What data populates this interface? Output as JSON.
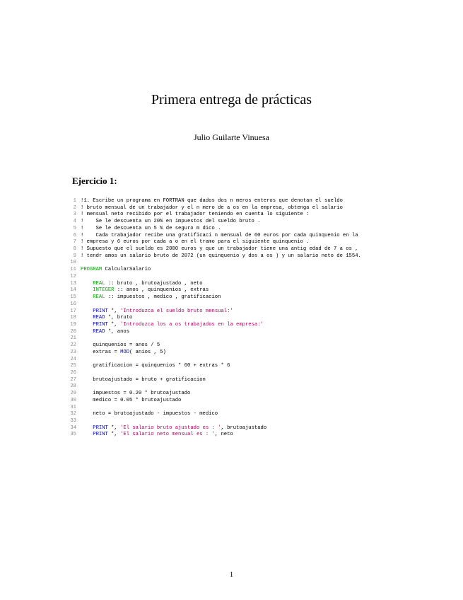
{
  "title": "Primera entrega de prácticas",
  "author": "Julio Guilarte Vinuesa",
  "section": "Ejercicio 1:",
  "page_number": "1",
  "code": [
    {
      "n": 1,
      "wrap": true,
      "segs": [
        {
          "t": "!1. Escribe un programa en FORTRAN que dados dos n meros enteros que denotan el sueldo"
        }
      ]
    },
    {
      "n": 2,
      "wrap": true,
      "segs": [
        {
          "t": "! bruto mensual de un trabajador y el n mero de a os en la empresa, obtenga el salario"
        }
      ]
    },
    {
      "n": 3,
      "wrap": true,
      "segs": [
        {
          "t": "! mensual neto recibido por el trabajador teniendo en cuenta lo siguiente :"
        }
      ]
    },
    {
      "n": 4,
      "segs": [
        {
          "t": "!    Se le descuenta un 20% en impuestos del sueldo bruto ."
        }
      ]
    },
    {
      "n": 5,
      "segs": [
        {
          "t": "!    Se le descuenta un 5 % de seguro m dico ."
        }
      ]
    },
    {
      "n": 6,
      "wrap": true,
      "segs": [
        {
          "t": "!    Cada trabajador recibe una gratificaci n mensual de 60 euros por cada quinquenio en la"
        }
      ]
    },
    {
      "n": 7,
      "wrap": true,
      "segs": [
        {
          "t": "! empresa y 6 euros por cada a o en el tramo para el siguiente quinquenio ."
        }
      ]
    },
    {
      "n": 8,
      "wrap": true,
      "segs": [
        {
          "t": "! Supuesto que el sueldo es 2000 euros y que un trabajador tiene una antig edad de 7 a os ,"
        }
      ]
    },
    {
      "n": 9,
      "wrap": true,
      "segs": [
        {
          "t": "! tendr amos un salario bruto de 2072 (un quinquenio y dos a os ) y un salario neto de 1554."
        }
      ]
    },
    {
      "n": 10,
      "segs": [
        {
          "t": ""
        }
      ]
    },
    {
      "n": 11,
      "segs": [
        {
          "t": "PROGRAM",
          "c": "kw"
        },
        {
          "t": " CalcularSalario"
        }
      ]
    },
    {
      "n": 12,
      "segs": [
        {
          "t": ""
        }
      ]
    },
    {
      "n": 13,
      "segs": [
        {
          "t": "    "
        },
        {
          "t": "REAL",
          "c": "kw"
        },
        {
          "t": " :: bruto , brutoajustado , neto"
        }
      ]
    },
    {
      "n": 14,
      "segs": [
        {
          "t": "    "
        },
        {
          "t": "INTEGER",
          "c": "kw"
        },
        {
          "t": " :: anos , quinquenios , extras"
        }
      ]
    },
    {
      "n": 15,
      "segs": [
        {
          "t": "    "
        },
        {
          "t": "REAL",
          "c": "kw"
        },
        {
          "t": " :: impuestos , medico , gratificacion"
        }
      ]
    },
    {
      "n": 16,
      "segs": [
        {
          "t": ""
        }
      ]
    },
    {
      "n": 17,
      "segs": [
        {
          "t": "    "
        },
        {
          "t": "PRINT",
          "c": "fn"
        },
        {
          "t": " *, "
        },
        {
          "t": "'Introduzca el sueldo bruto mensual:'",
          "c": "str"
        }
      ]
    },
    {
      "n": 18,
      "segs": [
        {
          "t": "    "
        },
        {
          "t": "READ",
          "c": "fn"
        },
        {
          "t": " *, bruto"
        }
      ]
    },
    {
      "n": 19,
      "segs": [
        {
          "t": "    "
        },
        {
          "t": "PRINT",
          "c": "fn"
        },
        {
          "t": " *, "
        },
        {
          "t": "'Introduzca los a os trabajados en la empresa:'",
          "c": "str"
        }
      ]
    },
    {
      "n": 20,
      "segs": [
        {
          "t": "    "
        },
        {
          "t": "READ",
          "c": "fn"
        },
        {
          "t": " *, anos"
        }
      ]
    },
    {
      "n": 21,
      "segs": [
        {
          "t": ""
        }
      ]
    },
    {
      "n": 22,
      "segs": [
        {
          "t": "    quinquenios = anos / 5"
        }
      ]
    },
    {
      "n": 23,
      "segs": [
        {
          "t": "    extras = "
        },
        {
          "t": "MOD",
          "c": "fn"
        },
        {
          "t": "( anios , 5)"
        }
      ]
    },
    {
      "n": 24,
      "segs": [
        {
          "t": ""
        }
      ]
    },
    {
      "n": 25,
      "segs": [
        {
          "t": "    gratificacion = quinquenios * 60 + extras * 6"
        }
      ]
    },
    {
      "n": 26,
      "segs": [
        {
          "t": ""
        }
      ]
    },
    {
      "n": 27,
      "segs": [
        {
          "t": "    brutoajustado = bruto + gratificacion"
        }
      ]
    },
    {
      "n": 28,
      "segs": [
        {
          "t": ""
        }
      ]
    },
    {
      "n": 29,
      "segs": [
        {
          "t": "    impuestos = 0.20 * brutoajustado"
        }
      ]
    },
    {
      "n": 30,
      "segs": [
        {
          "t": "    medico = 0.05 * brutoajustado"
        }
      ]
    },
    {
      "n": 31,
      "segs": [
        {
          "t": ""
        }
      ]
    },
    {
      "n": 32,
      "segs": [
        {
          "t": "    neto = brutoajustado - impuestos - medico"
        }
      ]
    },
    {
      "n": 33,
      "segs": [
        {
          "t": ""
        }
      ]
    },
    {
      "n": 34,
      "segs": [
        {
          "t": "    "
        },
        {
          "t": "PRINT",
          "c": "fn"
        },
        {
          "t": " *, "
        },
        {
          "t": "'El salario bruto ajustado es : '",
          "c": "str"
        },
        {
          "t": ", brutoajustado"
        }
      ]
    },
    {
      "n": 35,
      "segs": [
        {
          "t": "    "
        },
        {
          "t": "PRINT",
          "c": "fn"
        },
        {
          "t": " *, "
        },
        {
          "t": "'El salario neto mensual es : '",
          "c": "str"
        },
        {
          "t": ", neto"
        }
      ]
    }
  ]
}
